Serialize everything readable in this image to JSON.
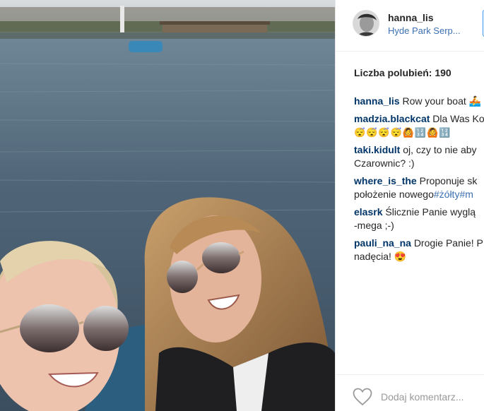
{
  "post": {
    "username": "hanna_lis",
    "location": "Hyde Park Serp...",
    "likes_text": "Liczba polubień: 190",
    "add_comment_placeholder": "Dodaj komentarz..."
  },
  "comments": [
    {
      "user": "hanna_lis",
      "text": "Row your boat 🚣"
    },
    {
      "user": "madzia.blackcat",
      "text": "Dla Was Ko",
      "line2": "😴😴😴😴🙆🔢🙆🔢"
    },
    {
      "user": "taki.kidult",
      "text": "oj, czy to nie aby",
      "line2": "Czarownic? :)"
    },
    {
      "user": "where_is_the",
      "text": "Proponuje sk",
      "line2": "położenie nowego",
      "tags": "#żółty#m"
    },
    {
      "user": "elasrk",
      "text": "Ślicznie Panie wyglą",
      "line2": "-mega ;-)"
    },
    {
      "user": "pauli_na_na",
      "text": "Drogie Panie! P",
      "line2": "nadęcia! 😍"
    }
  ],
  "icons": {
    "heart": "heart-icon",
    "avatar": "avatar-photo"
  },
  "colors": {
    "username_blue": "#003569",
    "link_blue": "#3d70b2",
    "follow_blue": "#3897f0"
  }
}
